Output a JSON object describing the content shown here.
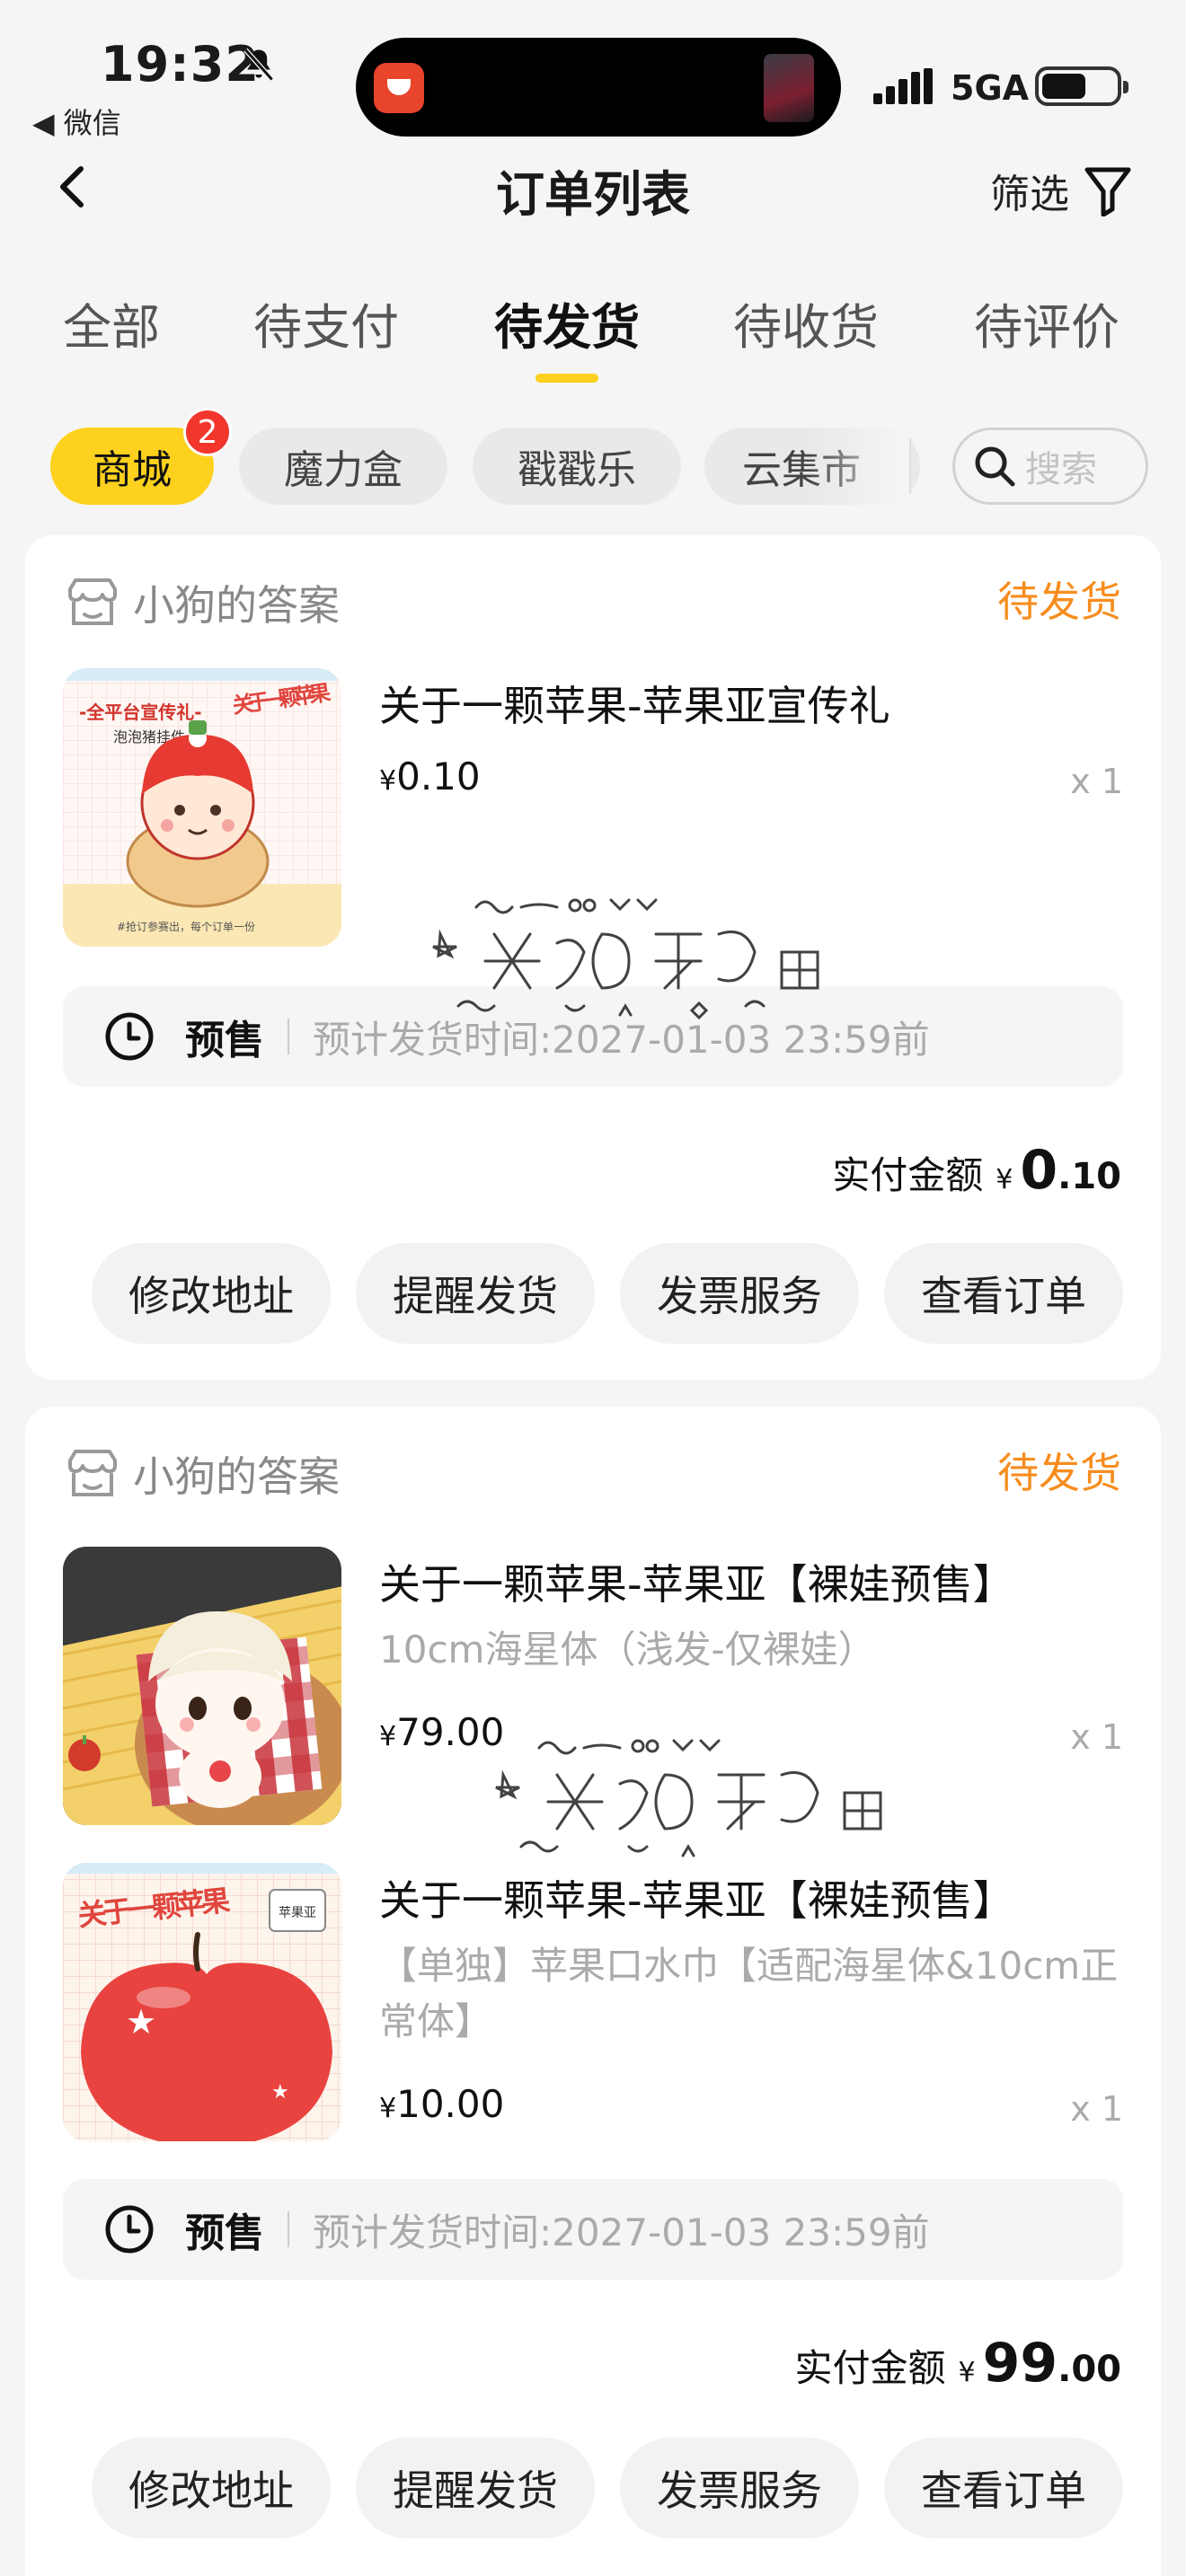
{
  "status_bar": {
    "time": "19:32",
    "back_app": "◀ 微信",
    "network": "5GA"
  },
  "nav": {
    "title": "订单列表",
    "filter_label": "筛选"
  },
  "tabs": [
    {
      "label": "全部"
    },
    {
      "label": "待支付"
    },
    {
      "label": "待发货",
      "active": true
    },
    {
      "label": "待收货"
    },
    {
      "label": "待评价"
    }
  ],
  "channels": [
    {
      "label": "商城",
      "badge": "2",
      "active": true
    },
    {
      "label": "魔力盒"
    },
    {
      "label": "戳戳乐"
    },
    {
      "label": "云集市"
    }
  ],
  "search": {
    "placeholder": "搜索"
  },
  "orders": [
    {
      "shop": "小狗的答案",
      "status": "待发货",
      "items": [
        {
          "title": "关于一颗苹果-苹果亚宣传礼",
          "spec": "",
          "price": "0.10",
          "currency": "¥",
          "qty": "x 1"
        }
      ],
      "presale": {
        "label": "预售",
        "text": "预计发货时间:2027-01-03 23:59前"
      },
      "total": {
        "label": "实付金额",
        "currency": "¥",
        "int": "0",
        "dec": ".10"
      },
      "actions": [
        "修改地址",
        "提醒发货",
        "发票服务",
        "查看订单"
      ]
    },
    {
      "shop": "小狗的答案",
      "status": "待发货",
      "items": [
        {
          "title": "关于一颗苹果-苹果亚【裸娃预售】",
          "spec": "10cm海星体（浅发-仅裸娃）",
          "price": "79.00",
          "currency": "¥",
          "qty": "x 1"
        },
        {
          "title": "关于一颗苹果-苹果亚【裸娃预售】",
          "spec": "【单独】苹果口水巾【适配海星体&10cm正常体】",
          "price": "10.00",
          "currency": "¥",
          "qty": "x 1"
        }
      ],
      "presale": {
        "label": "预售",
        "text": "预计发货时间:2027-01-03 23:59前"
      },
      "total": {
        "label": "实付金额",
        "currency": "¥",
        "int": "99",
        "dec": ".00"
      },
      "actions": [
        "修改地址",
        "提醒发货",
        "发票服务",
        "查看订单"
      ]
    }
  ],
  "thumb_texts": {
    "poster_line1": "-全平台宣传礼-",
    "poster_line2": "泡泡猪挂件",
    "poster_brand": "关于一颗苹果",
    "poster_note": "#抢订参赛出，每个订单一份",
    "bib_brand": "关于一颗苹果",
    "bib_tag": "苹果亚"
  },
  "colors": {
    "accent_yellow": "#fdd11d",
    "status_orange": "#f78d1e",
    "badge_red": "#f2362d"
  }
}
